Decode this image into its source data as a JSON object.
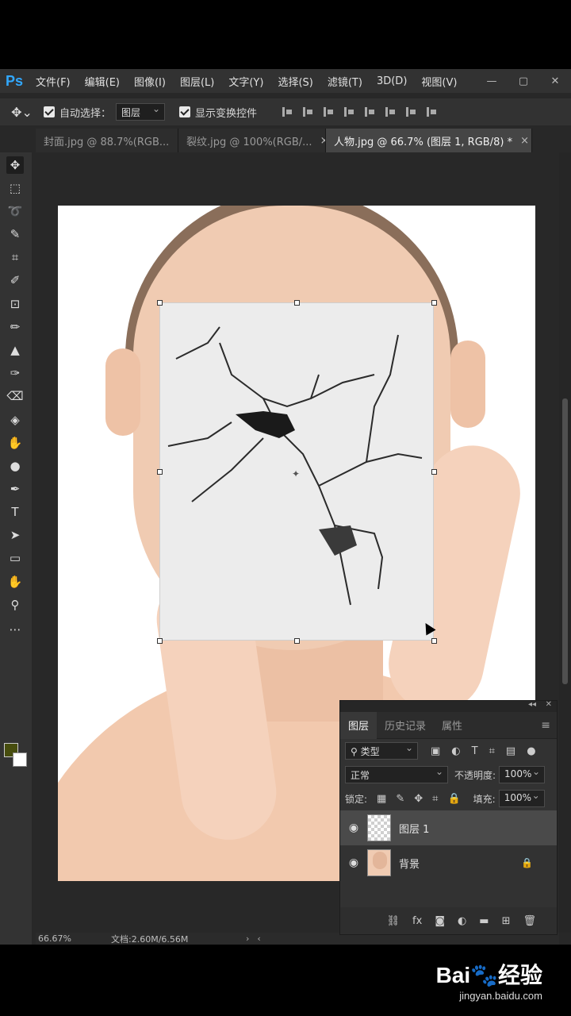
{
  "app": {
    "logo": "Ps",
    "menu": [
      "文件(F)",
      "编辑(E)",
      "图像(I)",
      "图层(L)",
      "文字(Y)",
      "选择(S)",
      "滤镜(T)",
      "3D(D)",
      "视图(V)"
    ],
    "window_controls": [
      "—",
      "▢",
      "✕"
    ]
  },
  "options": {
    "auto_select_label": "自动选择：",
    "auto_select_value": "图层",
    "show_transform_label": "显示变换控件"
  },
  "tabs": [
    {
      "label": "封面.jpg @ 88.7%(RGB...",
      "close": "×"
    },
    {
      "label": "裂纹.jpg @ 100%(RGB/...",
      "close": "×"
    },
    {
      "label": "人物.jpg @ 66.7% (图层 1, RGB/8) *",
      "close": "×"
    }
  ],
  "tools": [
    "move-tool",
    "marquee-tool",
    "lasso-tool",
    "quick-select-tool",
    "crop-tool",
    "eyedropper-tool",
    "healing-brush-tool",
    "brush-tool",
    "clone-stamp-tool",
    "history-brush-tool",
    "eraser-tool",
    "paint-bucket-tool",
    "smudge-tool",
    "dodge-tool",
    "pen-tool",
    "type-tool",
    "path-select-tool",
    "rectangle-tool",
    "hand-tool",
    "zoom-tool",
    "more-tools"
  ],
  "tool_glyphs": [
    "✥",
    "⬚",
    "➰",
    "✎",
    "⌗",
    "✐",
    "⊡",
    "✏",
    "▲",
    "✑",
    "⌫",
    "◈",
    "✋",
    "●",
    "✒",
    "T",
    "➤",
    "▭",
    "✋",
    "⚲",
    "⋯"
  ],
  "colors": {
    "foreground": "#474d0e",
    "background": "#ffffff"
  },
  "status": {
    "zoom": "66.67%",
    "doc_info": "文档:2.60M/6.56M"
  },
  "layers_panel": {
    "tabs": [
      "图层",
      "历史记录",
      "属性"
    ],
    "filter_kind": "类型",
    "blend_mode": "正常",
    "opacity_label": "不透明度:",
    "opacity_value": "100%",
    "lock_label": "锁定:",
    "fill_label": "填充:",
    "fill_value": "100%",
    "layers": [
      {
        "name": "图层 1",
        "visible": true,
        "active": true
      },
      {
        "name": "背景",
        "visible": true,
        "active": false,
        "locked": true
      }
    ]
  },
  "watermark": {
    "logo": "Bai🐾经验",
    "url": "jingyan.baidu.com"
  }
}
